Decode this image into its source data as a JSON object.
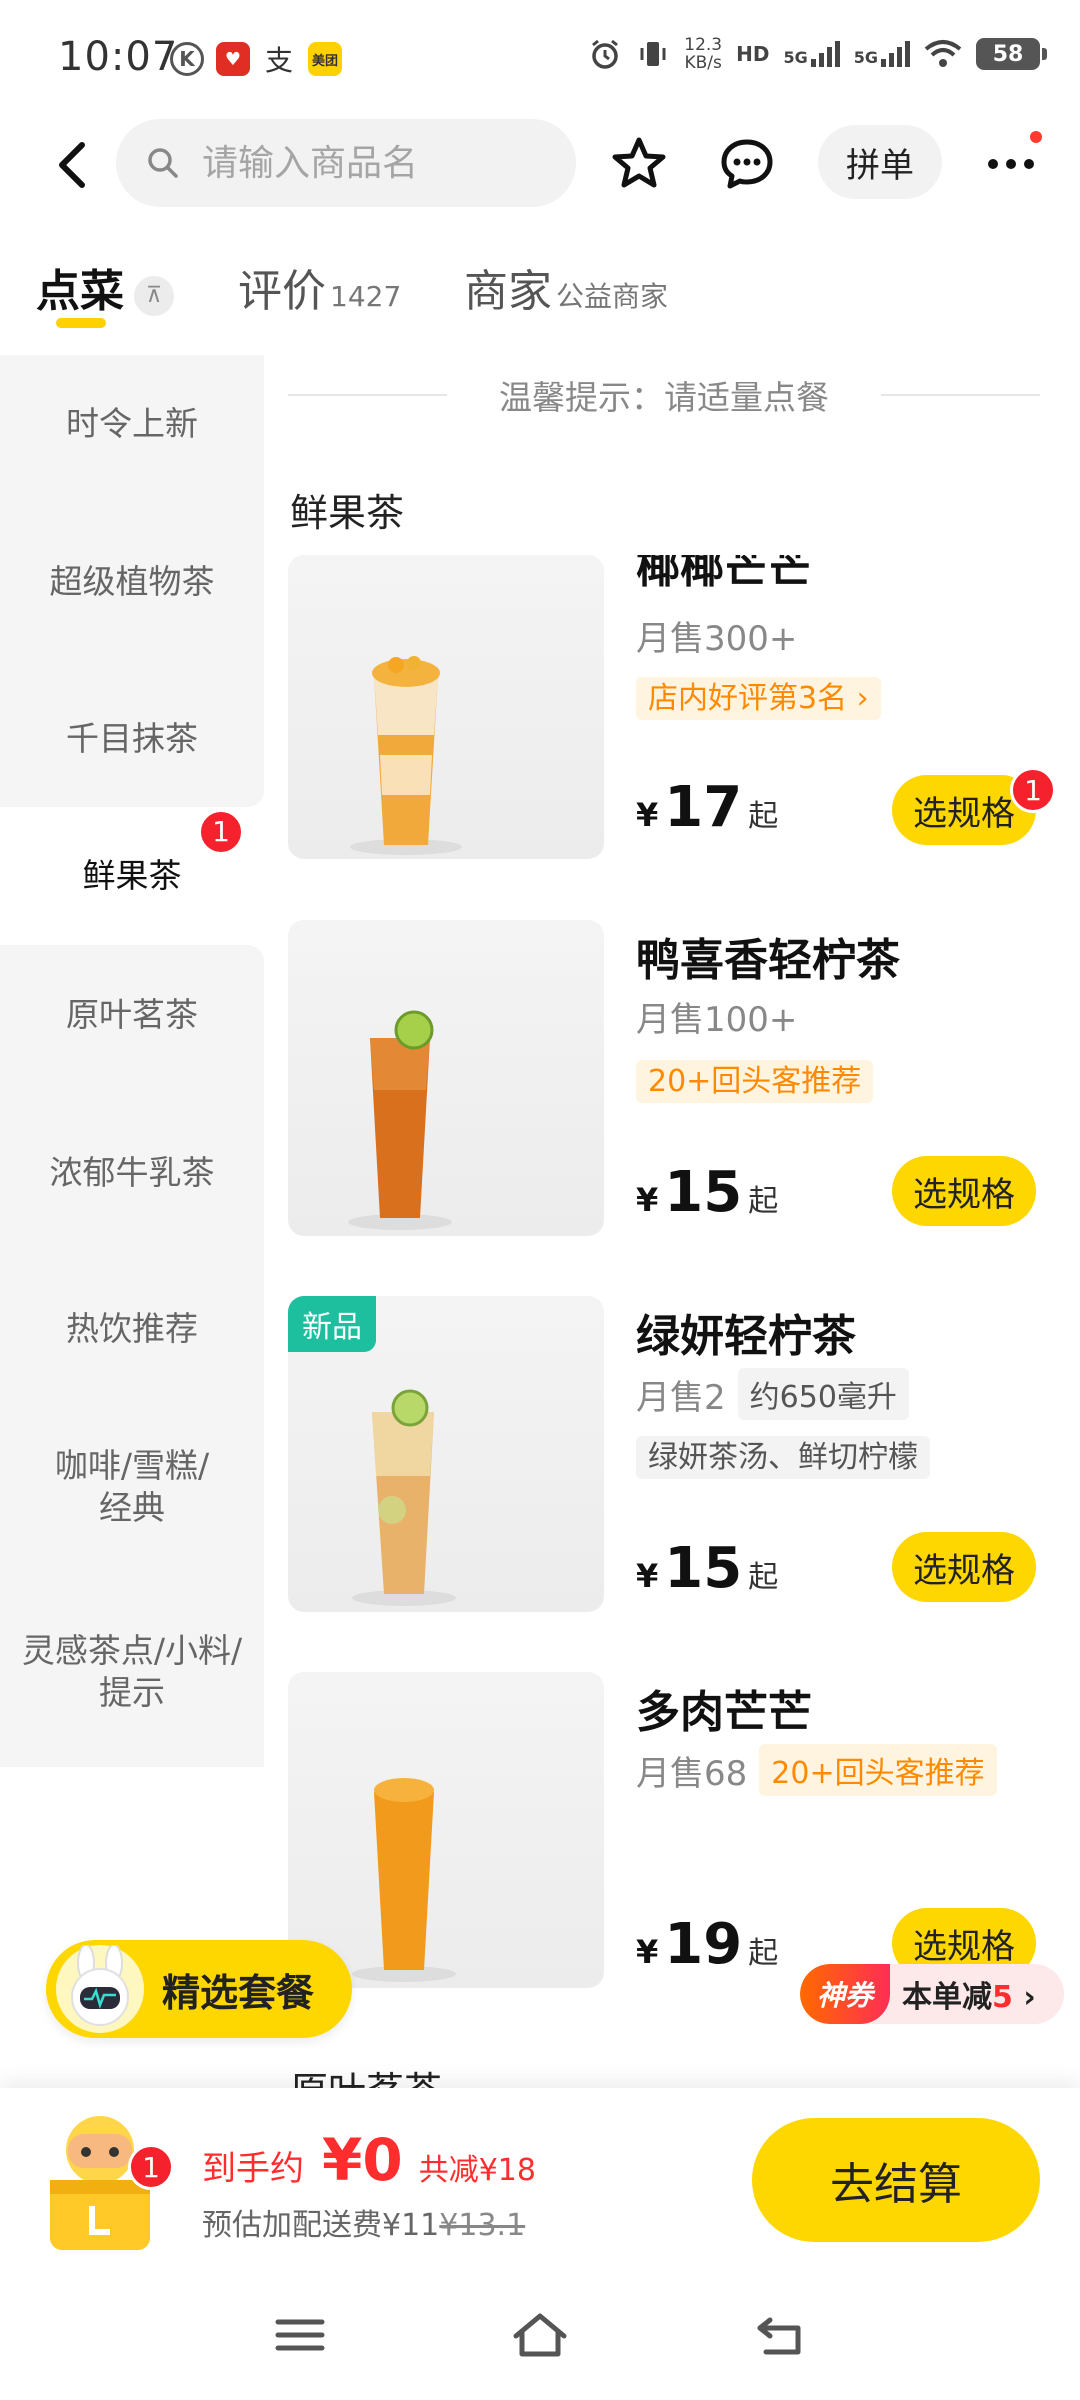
{
  "status_bar": {
    "time": "10:07",
    "net_speed_value": "12.3",
    "net_speed_unit": "KB/s",
    "hd_label": "HD",
    "sim1_label": "5G",
    "sim2_label": "5G",
    "battery": "58",
    "app_icons": [
      "k-icon",
      "pinduoduo-icon",
      "alipay-icon",
      "meituan-icon"
    ]
  },
  "topnav": {
    "search_placeholder": "请输入商品名",
    "pin_label": "拼单"
  },
  "tabs": [
    {
      "label": "点菜",
      "sub": "",
      "active": true
    },
    {
      "label": "评价",
      "sub": "1427",
      "active": false
    },
    {
      "label": "商家",
      "sub": "公益商家",
      "active": false
    }
  ],
  "sidebar": {
    "items": [
      {
        "label": "时令上新"
      },
      {
        "label": "超级植物茶"
      },
      {
        "label": "千目抹茶"
      },
      {
        "label": "鲜果茶",
        "badge": "1"
      },
      {
        "label": "原叶茗茶"
      },
      {
        "label": "浓郁牛乳茶"
      },
      {
        "label": "热饮推荐"
      },
      {
        "label": "咖啡/雪糕/经典"
      },
      {
        "label": "灵感茶点/小料/提示"
      }
    ]
  },
  "main": {
    "tip": "温馨提示：请适量点餐",
    "category_title": "鲜果茶",
    "next_category": "原叶茗茶",
    "products": [
      {
        "name": "椰椰芒芒",
        "sales": "月售300+",
        "tag": "店内好评第3名",
        "tag_arrow": "›",
        "price_symbol": "¥",
        "price": "17",
        "price_suffix": "起",
        "button": "选规格",
        "badge": "1"
      },
      {
        "name": "鸭喜香轻柠茶",
        "sales": "月售100+",
        "tag": "20+回头客推荐",
        "price_symbol": "¥",
        "price": "15",
        "price_suffix": "起",
        "button": "选规格"
      },
      {
        "name": "绿妍轻柠茶",
        "new_tag": "新品",
        "sales": "月售2",
        "volume": "约650毫升",
        "desc": "绿妍茶汤、鲜切柠檬",
        "price_symbol": "¥",
        "price": "15",
        "price_suffix": "起",
        "button": "选规格"
      },
      {
        "name": "多肉芒芒",
        "sales": "月售68",
        "tag": "20+回头客推荐",
        "price_symbol": "¥",
        "price": "19",
        "price_suffix": "起",
        "button": "选规格"
      }
    ]
  },
  "floating": {
    "combo_label": "精选套餐",
    "coupon_tag": "神券",
    "coupon_prefix": "本单减",
    "coupon_amount": "5",
    "coupon_arrow": "›"
  },
  "cart": {
    "badge": "1",
    "total_label": "到手约",
    "total_amount": "¥0",
    "saved": "共减¥18",
    "fee_label": "预估加配送费¥11",
    "fee_original": "¥13.1",
    "checkout_label": "去结算"
  },
  "colors": {
    "brand_yellow": "#ffd700",
    "badge_red": "#f5222d",
    "price_red": "#ff2d2d",
    "tag_orange": "#ff8a00",
    "new_tag_green": "#1dbf9f"
  }
}
